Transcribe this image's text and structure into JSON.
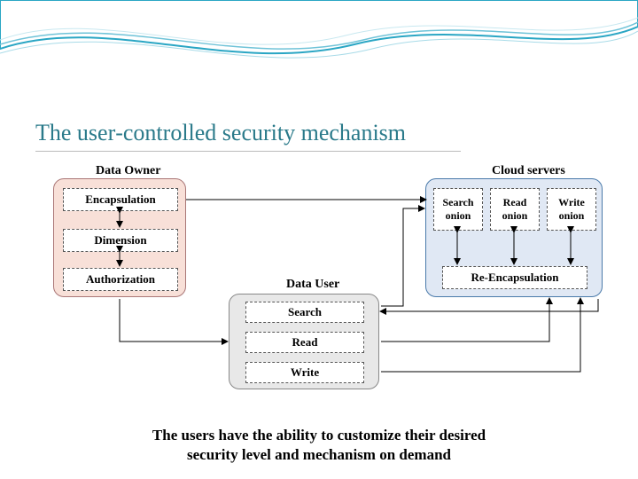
{
  "title": "The user‑controlled security mechanism",
  "owner": {
    "label": "Data Owner",
    "items": [
      "Encapsulation",
      "Dimension",
      "Authorization"
    ]
  },
  "user": {
    "label": "Data User",
    "items": [
      "Search",
      "Read",
      "Write"
    ]
  },
  "cloud": {
    "label": "Cloud servers",
    "onions": [
      "Search\nonion",
      "Read\nonion",
      "Write\nonion"
    ],
    "re": "Re-Encapsulation"
  },
  "caption": "The users have the ability  to customize their desired\nsecurity level and mechanism on  demand"
}
